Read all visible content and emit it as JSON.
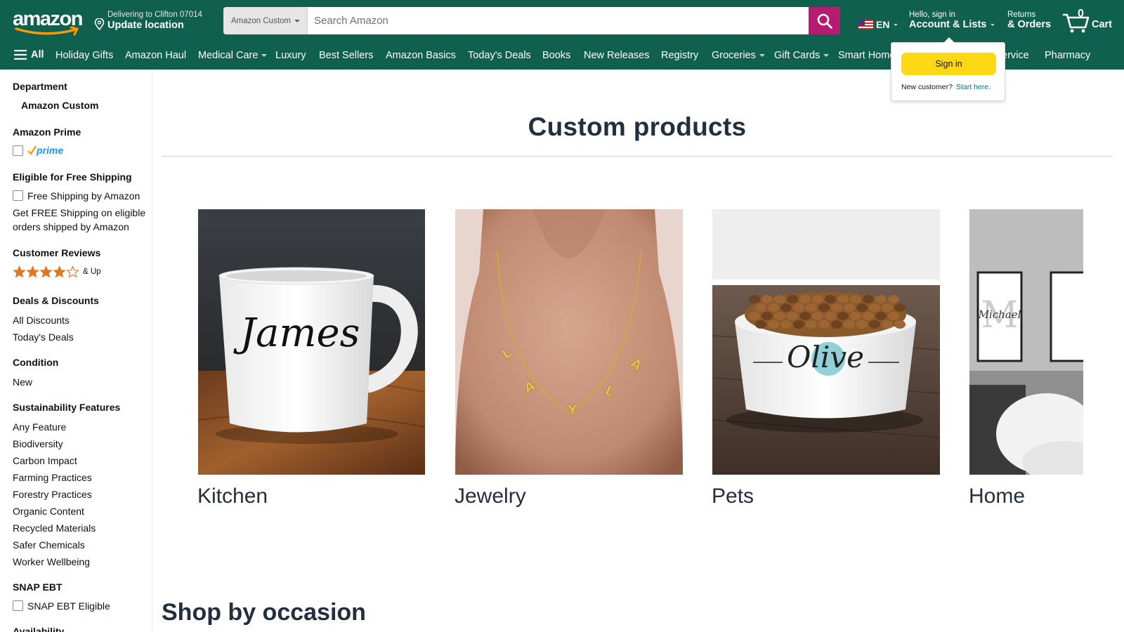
{
  "header": {
    "logo_text": "amazon",
    "deliver_line1": "Delivering to Clifton 07014",
    "deliver_line2": "Update location",
    "search_scope": "Amazon Custom",
    "search_placeholder": "Search Amazon",
    "language": "EN",
    "account_line1": "Hello, sign in",
    "account_line2": "Account & Lists",
    "returns_line1": "Returns",
    "returns_line2": "& Orders",
    "cart_count": "0",
    "cart_label": "Cart",
    "bar_color": "#10604e"
  },
  "nav": {
    "all_label": "All",
    "items": [
      {
        "label": "Holiday Gifts"
      },
      {
        "label": "Amazon Haul"
      },
      {
        "label": "Medical Care"
      },
      {
        "label": "Luxury"
      },
      {
        "label": "Best Sellers"
      },
      {
        "label": "Amazon Basics"
      },
      {
        "label": "Today's Deals"
      },
      {
        "label": "Books"
      },
      {
        "label": "New Releases"
      },
      {
        "label": "Registry"
      },
      {
        "label": "Groceries"
      },
      {
        "label": "Gift Cards"
      },
      {
        "label": "Smart Home"
      },
      {
        "label": "ervice"
      },
      {
        "label": "Pharmacy"
      }
    ]
  },
  "signin_popup": {
    "button": "Sign in",
    "new_customer": "New customer?",
    "start_here": "Start here."
  },
  "sidebar": {
    "department": "Department",
    "department_item": "Amazon Custom",
    "prime_heading": "Amazon Prime",
    "prime_logo": "prime",
    "shipping_heading": "Eligible for Free Shipping",
    "shipping_option": "Free Shipping by Amazon",
    "shipping_note_1": "Get FREE Shipping on eligible",
    "shipping_note_2": "orders shipped by Amazon",
    "reviews_heading": "Customer Reviews",
    "reviews_stars": 4,
    "reviews_suffix": "& Up",
    "deals_heading": "Deals & Discounts",
    "deals_items": [
      "All Discounts",
      "Today's Deals"
    ],
    "condition_heading": "Condition",
    "condition_items": [
      "New"
    ],
    "sustain_heading": "Sustainability Features",
    "sustain_items": [
      "Any Feature",
      "Biodiversity",
      "Carbon Impact",
      "Farming Practices",
      "Forestry Practices",
      "Organic Content",
      "Recycled Materials",
      "Safer Chemicals",
      "Worker Wellbeing"
    ],
    "snap_heading": "SNAP EBT",
    "snap_option": "SNAP EBT Eligible",
    "availability_heading": "Availability"
  },
  "main": {
    "title": "Custom products",
    "categories": [
      {
        "label": "Kitchen",
        "image_text": "James"
      },
      {
        "label": "Jewelry",
        "image_text": "LAYLA"
      },
      {
        "label": "Pets",
        "image_text": "Olive"
      },
      {
        "label": "Home",
        "image_text": "Michael"
      }
    ],
    "occasion_title": "Shop by occasion"
  }
}
